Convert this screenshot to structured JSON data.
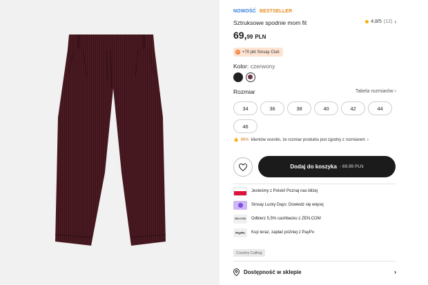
{
  "product": {
    "tag_new": "NOWOŚĆ",
    "tag_bestseller": "BESTSELLER",
    "title": "Sztruksowe spodnie mom fit",
    "rating_value": "4,8/5",
    "rating_count": "(12)",
    "price_main": "69,",
    "price_cents": "99",
    "currency": "PLN",
    "club_badge": "+70 pkt Sinsay Club"
  },
  "color": {
    "label": "Kolor:",
    "value": "czerwony",
    "swatches": [
      "#222222",
      "#6a3440"
    ]
  },
  "sizes": {
    "label": "Rozmiar",
    "table_link": "Tabela rozmiarów",
    "options": [
      "34",
      "36",
      "38",
      "40",
      "42",
      "44",
      "46"
    ]
  },
  "fit": {
    "percent": "86%",
    "text": "klientów oceniło, że rozmiar produktu jest zgodny z rozmiarem"
  },
  "actions": {
    "cart_label": "Dodaj do koszyka",
    "cart_price": "- 69,99 PLN"
  },
  "promos": [
    {
      "icon": "poland-flag-icon",
      "text": "Jesteśmy z Polski! Poznaj nas bliżej"
    },
    {
      "icon": "lucky-days-icon",
      "text": "Sinsay Lucky Days: Dowiedz się więcej"
    },
    {
      "icon": "zen-com-icon",
      "text": "Odbierz 5,5% cashbacku z ZEN.COM"
    },
    {
      "icon": "paypo-icon",
      "text": "Kup teraz, zapłać później z PayPo"
    }
  ],
  "icon_labels": {
    "zen": "ZEN.COM",
    "paypo": "PayPo"
  },
  "country_calling": "Country Calling",
  "store": {
    "label": "Dostępność w sklepie"
  },
  "colors": {
    "accent_blue": "#2f7ddc",
    "accent_orange": "#e58a1c",
    "cart_bg": "#1b1b1b",
    "club_bg": "#fde3d2",
    "trousers": "#4a1a22"
  }
}
